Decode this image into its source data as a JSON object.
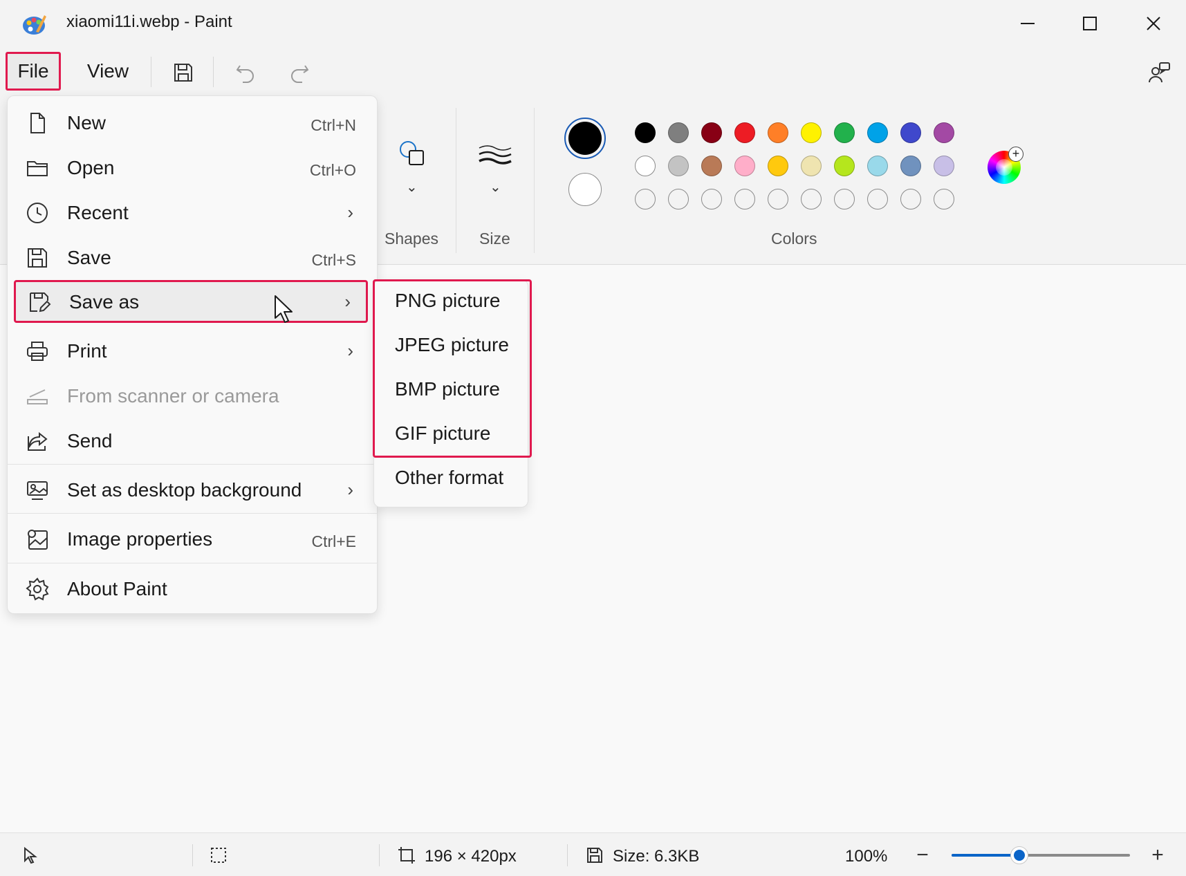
{
  "window": {
    "title": "xiaomi11i.webp - Paint",
    "app_icon": "paint-palette-icon",
    "controls": [
      "minimize-icon",
      "maximize-icon",
      "close-icon"
    ]
  },
  "menubar": {
    "file_label": "File",
    "view_label": "View",
    "quick_icons": [
      "save-icon",
      "undo-icon",
      "redo-icon"
    ],
    "right_icon": "share-people-icon"
  },
  "ribbon": {
    "shapes_label": "Shapes",
    "size_label": "Size",
    "colors_label": "Colors",
    "primary_color": "#000000",
    "secondary_color": "#ffffff",
    "palette_row1": [
      "#000000",
      "#7f7f7f",
      "#880015",
      "#ed1c24",
      "#ff7f27",
      "#fff200",
      "#22b14c",
      "#00a2e8",
      "#3f48cc",
      "#a349a4"
    ],
    "palette_row2": [
      "#ffffff",
      "#c3c3c3",
      "#b97a57",
      "#ffaec9",
      "#ffc90e",
      "#efe4b0",
      "#b5e61d",
      "#99d9ea",
      "#7092be",
      "#c8bfe7"
    ],
    "custom_slots": 10,
    "edit_colors_icon": "color-wheel-icon"
  },
  "file_menu": {
    "new": {
      "label": "New",
      "shortcut": "Ctrl+N"
    },
    "open": {
      "label": "Open",
      "shortcut": "Ctrl+O"
    },
    "recent": {
      "label": "Recent"
    },
    "save": {
      "label": "Save",
      "shortcut": "Ctrl+S"
    },
    "save_as": {
      "label": "Save as"
    },
    "print": {
      "label": "Print"
    },
    "scanner": {
      "label": "From scanner or camera"
    },
    "send": {
      "label": "Send"
    },
    "desktop_bg": {
      "label": "Set as desktop background"
    },
    "image_props": {
      "label": "Image properties",
      "shortcut": "Ctrl+E"
    },
    "about": {
      "label": "About Paint"
    }
  },
  "save_as_menu": {
    "png": "PNG picture",
    "jpeg": "JPEG picture",
    "bmp": "BMP picture",
    "gif": "GIF picture",
    "other": "Other format"
  },
  "status": {
    "dimensions": "196 × 420px",
    "file_size": "Size: 6.3KB",
    "zoom": "100%",
    "zoom_fraction": 0.38
  }
}
